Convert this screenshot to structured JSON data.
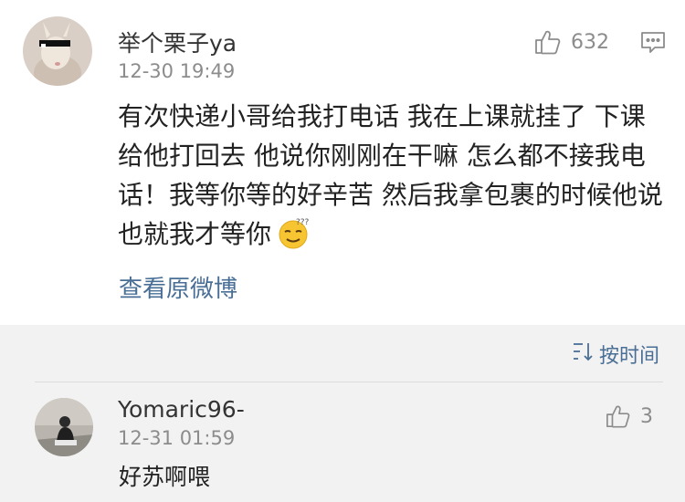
{
  "post": {
    "username": "举个栗子ya",
    "timestamp": "12-30 19:49",
    "like_count": "632",
    "text": "有次快递小哥给我打电话 我在上课就挂了 下课给他打回去 他说你刚刚在干嘛 怎么都不接我电话！我等你等的好辛苦 然后我拿包裹的时候他说也就我才等你",
    "view_original_label": "查看原微博",
    "icons": [
      "avatar",
      "thumbs-up-icon",
      "comment-icon",
      "thinking-emoji"
    ]
  },
  "comments_section": {
    "sort_label": "按时间",
    "sort_icon": "sort-icon"
  },
  "reply": {
    "username": "Yomaric96-",
    "timestamp": "12-31 01:59",
    "like_count": "3",
    "text": "好苏啊喂"
  },
  "colors": {
    "link": "#4a6f96",
    "secondary_text": "#8c8c8c",
    "background": "#f2f2f2"
  }
}
